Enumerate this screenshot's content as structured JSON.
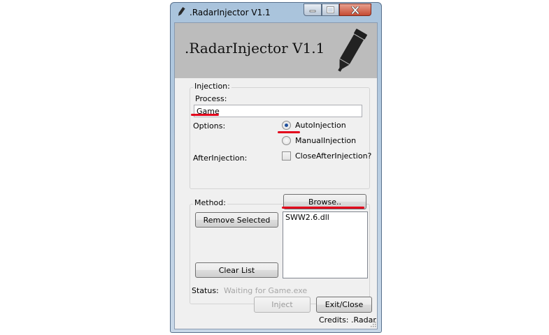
{
  "window": {
    "title": ".RadarInjector V1.1"
  },
  "banner": {
    "title": ".RadarInjector V1.1",
    "icon": "pen-icon"
  },
  "injection": {
    "group_label": "Injection:",
    "process_label": "Process:",
    "process_value": "Game",
    "options_label": "Options:",
    "auto_injection_label": "AutoInjection",
    "auto_injection_checked": true,
    "manual_injection_label": "ManualInjection",
    "manual_injection_checked": false,
    "after_injection_label": "AfterInjection:",
    "close_after_injection_label": "CloseAfterInjection?",
    "close_after_injection_checked": false
  },
  "method": {
    "group_label": "Method:",
    "browse_label": "Browse..",
    "remove_selected_label": "Remove Selected",
    "clear_list_label": "Clear List",
    "dll_items": [
      "SWW2.6.dll"
    ]
  },
  "status": {
    "label": "Status:",
    "value": "Waiting for Game.exe"
  },
  "buttons": {
    "inject_label": "Inject",
    "inject_enabled": false,
    "exit_label": "Exit/Close"
  },
  "credits": "Credits: .Radar",
  "colors": {
    "annotation_red": "#e3001b",
    "banner_gray": "#bcbcbc",
    "title_bar_blue": "#a9c3dc",
    "close_button_red": "#c54b33"
  }
}
